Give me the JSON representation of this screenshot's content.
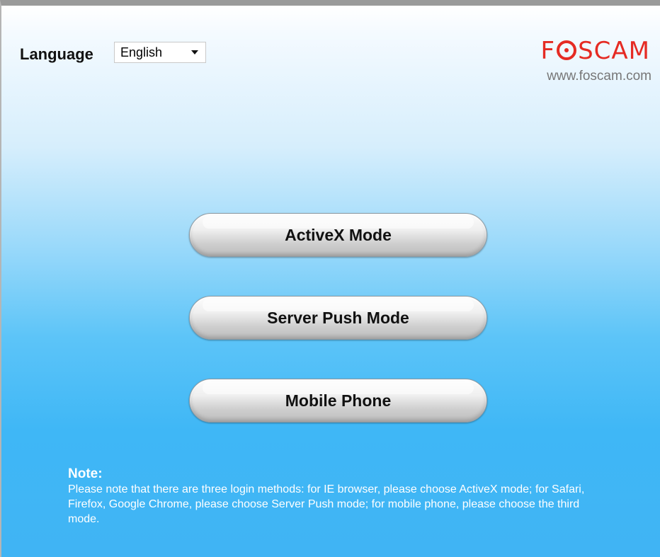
{
  "header": {
    "language_label": "Language",
    "language_selected": "English",
    "brand_left": "F",
    "brand_right": "SCAM",
    "brand_url": "www.foscam.com"
  },
  "modes": [
    {
      "label": "ActiveX Mode"
    },
    {
      "label": "Server Push Mode"
    },
    {
      "label": "Mobile Phone"
    }
  ],
  "note": {
    "title": "Note:",
    "text": "Please note that there are three login methods: for IE browser, please choose ActiveX mode; for Safari, Firefox, Google Chrome, please choose Server Push mode; for mobile phone, please choose the third mode."
  },
  "colors": {
    "brand": "#e52b23",
    "background_top": "#ffffff",
    "background_bottom": "#40b4f4"
  }
}
